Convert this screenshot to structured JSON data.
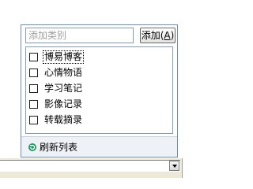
{
  "add_category": {
    "placeholder": "添加类别",
    "value": "",
    "button_label": "添加(",
    "button_accel": "A",
    "button_suffix": ")"
  },
  "categories": [
    {
      "label": "博易博客",
      "checked": false,
      "focused": true
    },
    {
      "label": "心情物语",
      "checked": false,
      "focused": false
    },
    {
      "label": "学习笔记",
      "checked": false,
      "focused": false
    },
    {
      "label": "影像记录",
      "checked": false,
      "focused": false
    },
    {
      "label": "转载摘录",
      "checked": false,
      "focused": false
    }
  ],
  "footer": {
    "refresh_label": "刷新列表",
    "refresh_icon": "refresh-icon",
    "refresh_icon_color": "#1e9a62"
  }
}
